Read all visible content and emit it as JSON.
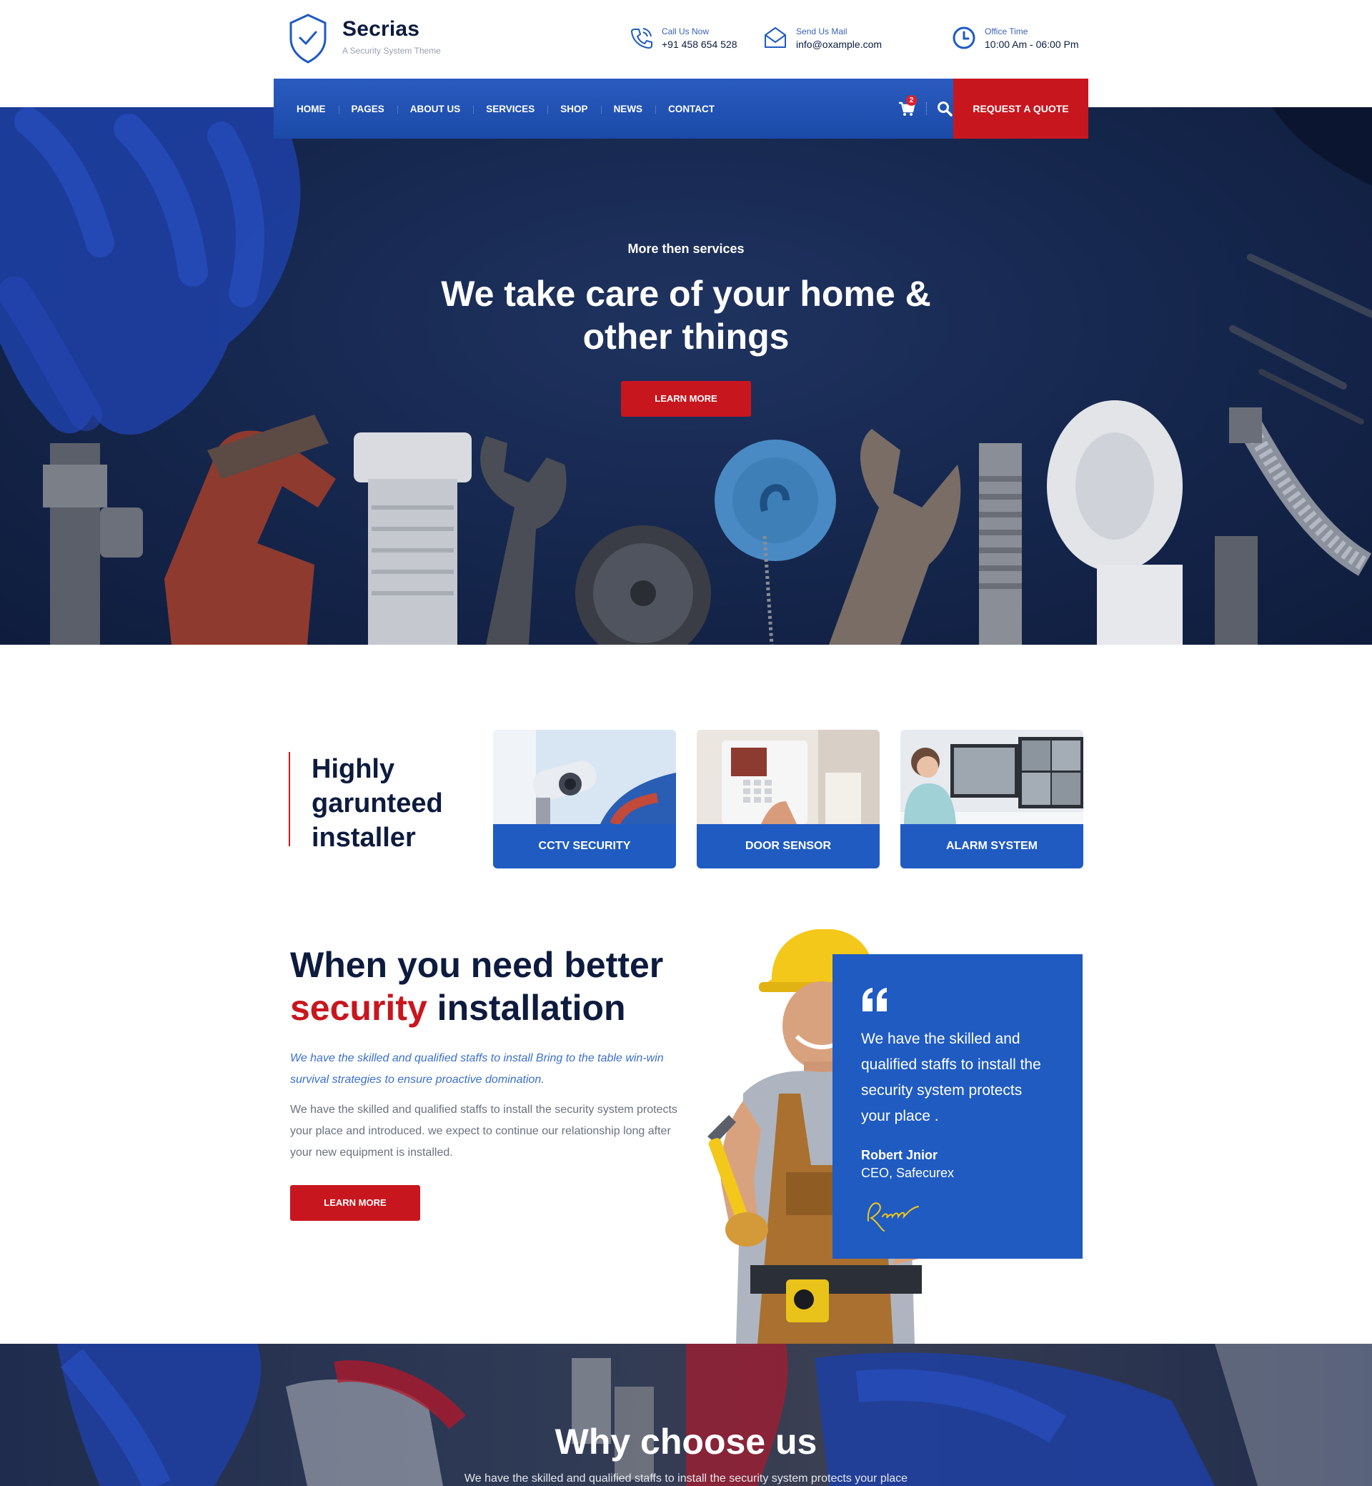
{
  "brand": {
    "name": "Secrias",
    "tagline": "A Security System Theme"
  },
  "contact": {
    "call_label": "Call Us Now",
    "call_value": "+91 458 654 528",
    "mail_label": "Send Us Mail",
    "mail_value": "info@oxample.com",
    "time_label": "Office Time",
    "time_value": "10:00 Am - 06:00 Pm"
  },
  "nav": {
    "items": [
      "HOME",
      "PAGES",
      "ABOUT US",
      "SERVICES",
      "SHOP",
      "NEWS",
      "CONTACT"
    ],
    "cart_count": "2",
    "quote_label": "REQUEST A QUOTE"
  },
  "hero": {
    "kicker": "More then services",
    "title": "We take care of your home & other things",
    "button": "LEARN MORE"
  },
  "installer": {
    "title": "Highly garunteed installer",
    "services": [
      {
        "label": "CCTV SECURITY"
      },
      {
        "label": "DOOR SENSOR"
      },
      {
        "label": "ALARM SYSTEM"
      }
    ]
  },
  "about": {
    "title_line1": "When you need better",
    "title_red": "security",
    "title_rest": " installation",
    "lead": "We have the skilled and qualified staffs to install Bring to the table win-win survival strategies to ensure proactive domination.",
    "body": "We have the skilled and qualified staffs to install the security system protects your place and introduced. we expect to continue our relationship long after your new equipment is installed.",
    "button": "LEARN MORE"
  },
  "testimonial": {
    "text": "We have the skilled and qualified staffs to install the security system protects your place .",
    "name": "Robert Jnior",
    "role": "CEO, Safecurex"
  },
  "why": {
    "title": "Why choose us",
    "subtitle": "We have the skilled and qualified staffs to install the security system protects your place"
  },
  "colors": {
    "primary": "#1f5bc1",
    "accent_red": "#c8161e",
    "navy": "#0d1b3e"
  }
}
